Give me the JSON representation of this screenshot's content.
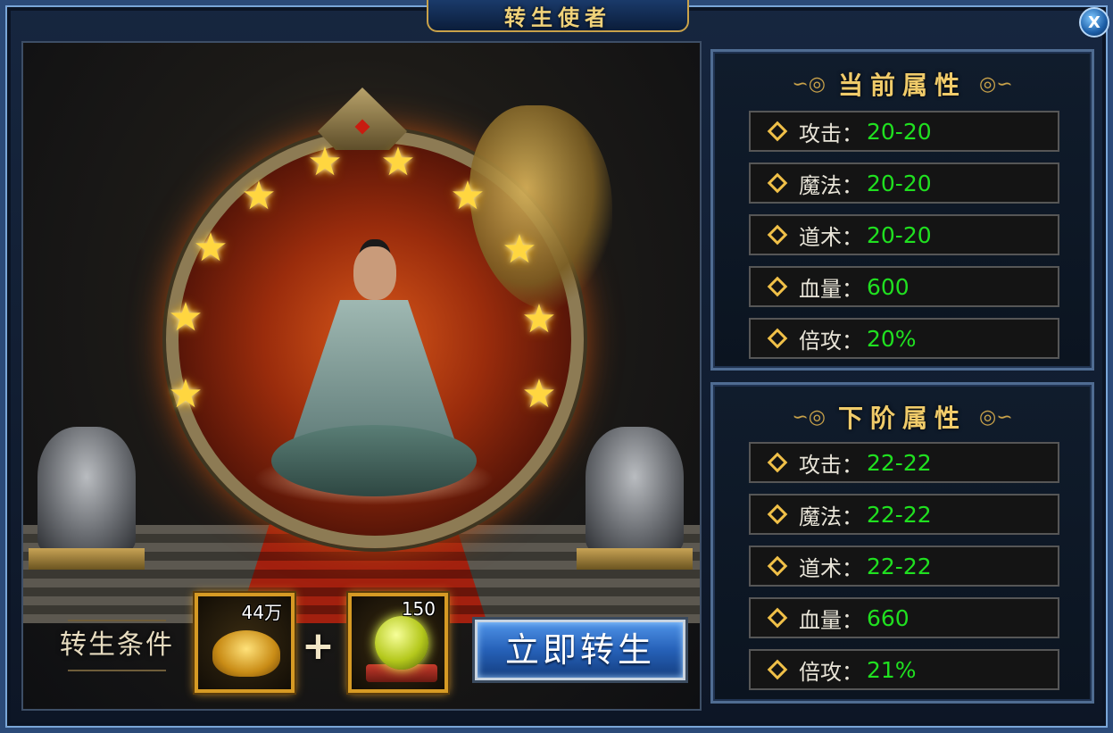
{
  "window": {
    "title": "转生使者",
    "close_label": "X"
  },
  "scene": {
    "stars_filled": 10
  },
  "conditions": {
    "label": "转生条件",
    "items": [
      {
        "icon": "gold-ingot-icon",
        "count": "44万"
      },
      {
        "icon": "rebirth-orb-icon",
        "count": "150"
      }
    ],
    "plus": "+",
    "button_label": "立即转生"
  },
  "current_attributes": {
    "title": "当前属性",
    "rows": [
      {
        "label": "攻击：",
        "value": "20-20"
      },
      {
        "label": "魔法：",
        "value": "20-20"
      },
      {
        "label": "道术：",
        "value": "20-20"
      },
      {
        "label": "血量：",
        "value": "600"
      },
      {
        "label": "倍攻：",
        "value": "20%"
      }
    ]
  },
  "next_attributes": {
    "title": "下阶属性",
    "rows": [
      {
        "label": "攻击：",
        "value": "22-22"
      },
      {
        "label": "魔法：",
        "value": "22-22"
      },
      {
        "label": "道术：",
        "value": "22-22"
      },
      {
        "label": "血量：",
        "value": "660"
      },
      {
        "label": "倍攻：",
        "value": "21%"
      }
    ]
  },
  "colors": {
    "value_green": "#20e020",
    "title_gold": "#f0cb6a",
    "button_blue": "#2661b8"
  }
}
